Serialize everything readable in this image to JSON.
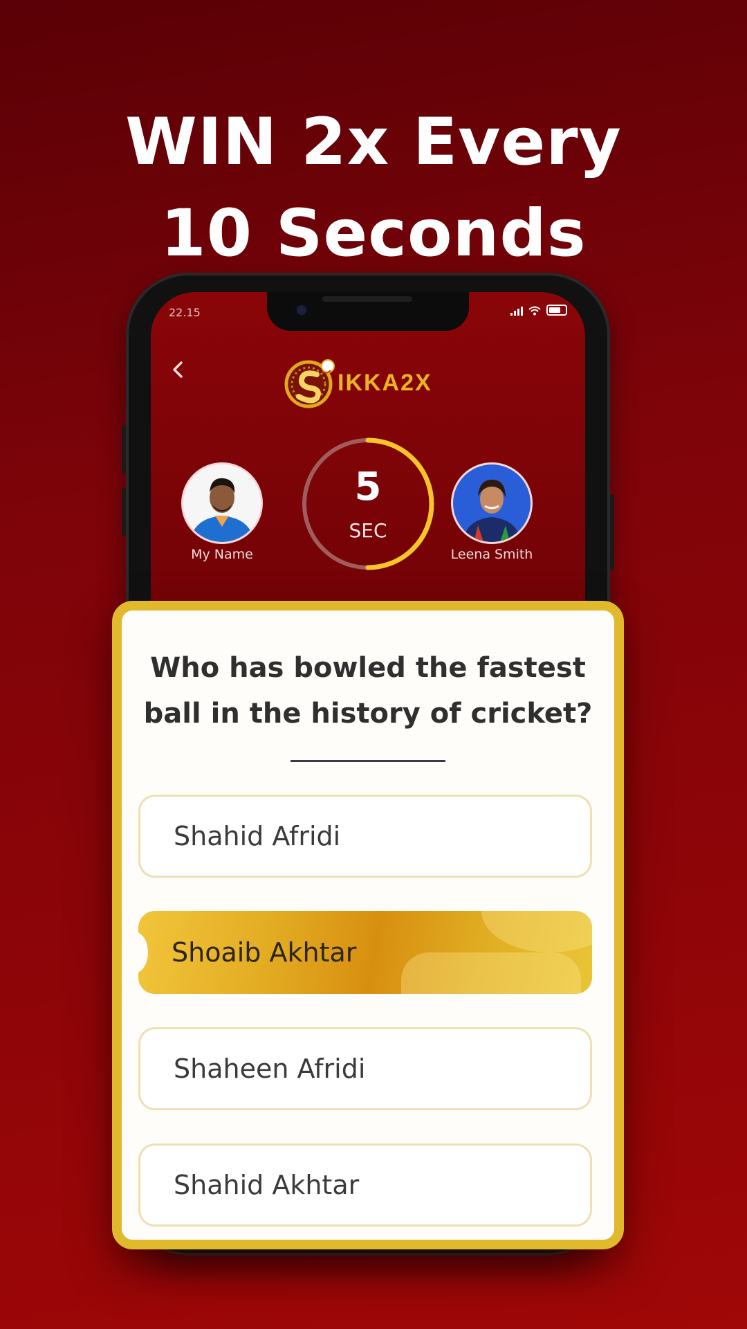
{
  "headline": {
    "line1": "WIN 2x Every",
    "line2": "10 Seconds"
  },
  "status_bar": {
    "time": "22.15"
  },
  "header": {
    "logo_text": "IKKA2X"
  },
  "players": [
    {
      "name": "My Name"
    },
    {
      "name": "Leena Smith"
    }
  ],
  "timer": {
    "value": "5",
    "unit": "SEC",
    "progress": 0.5
  },
  "quiz": {
    "question": "Who has bowled the fastest ball in the history of cricket?",
    "options": [
      {
        "label": "Shahid Afridi",
        "selected": false
      },
      {
        "label": "Shoaib Akhtar",
        "selected": true
      },
      {
        "label": "Shaheen Afridi",
        "selected": false
      },
      {
        "label": "Shahid Akhtar",
        "selected": false
      }
    ]
  },
  "colors": {
    "background": "#8f0508",
    "accent_gold": "#e1b92c",
    "timer_ring": "#f5c52a"
  }
}
